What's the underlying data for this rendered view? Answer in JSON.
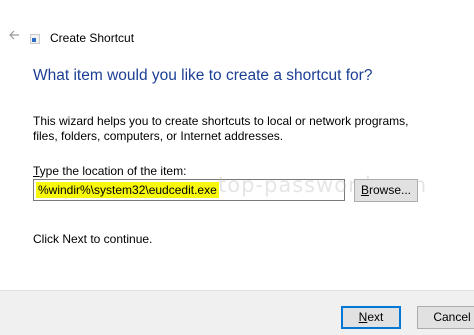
{
  "window": {
    "title": "Create Shortcut",
    "back_icon": "back-arrow-icon",
    "app_icon": "shortcut-icon"
  },
  "wizard": {
    "heading": "What item would you like to create a shortcut for?",
    "description": "This wizard helps you to create shortcuts to local or network programs, files, folders, computers, or Internet addresses.",
    "location_label_first": "T",
    "location_label_rest": "ype the location of the item:",
    "location_value": "%windir%\\system32\\eudcedit.exe",
    "browse_label_first": "B",
    "browse_label_rest": "rowse...",
    "hint": "Click Next to continue.",
    "watermark": "top-password.com"
  },
  "footer": {
    "next_label_first": "N",
    "next_label_rest": "ext",
    "cancel_label": "Cancel"
  },
  "colors": {
    "heading": "#1c3f94",
    "highlight": "#f7f70d",
    "focus_border": "#0078d7"
  }
}
